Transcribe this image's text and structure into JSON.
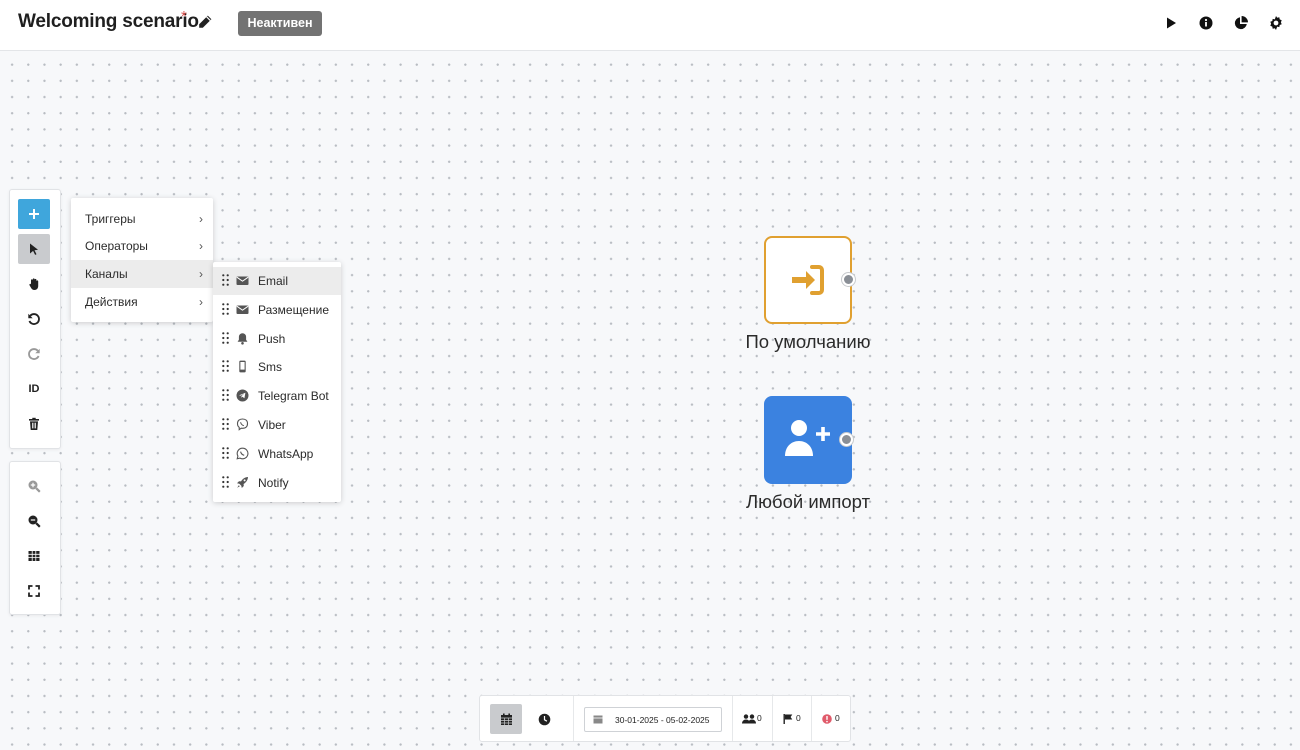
{
  "header": {
    "title": "Welcoming scenario",
    "unsaved_marker": "*",
    "status_badge": "Неактивен",
    "actions": [
      "play-icon",
      "info-icon",
      "stats-icon",
      "settings-icon"
    ]
  },
  "toolbar": {
    "tools": [
      "add",
      "select",
      "pan",
      "undo",
      "redo",
      "id",
      "delete"
    ],
    "id_label": "ID",
    "zoom_tools": [
      "zoom-in",
      "zoom-out",
      "grid",
      "fullscreen"
    ]
  },
  "add_menu": {
    "items": [
      {
        "label": "Триггеры",
        "chevron": "›"
      },
      {
        "label": "Операторы",
        "chevron": "›"
      },
      {
        "label": "Каналы",
        "chevron": "›",
        "active": true
      },
      {
        "label": "Действия",
        "chevron": "›"
      }
    ]
  },
  "channels_menu": {
    "items": [
      {
        "label": "Email",
        "icon": "envelope-icon",
        "active": true
      },
      {
        "label": "Размещение",
        "icon": "envelope-icon"
      },
      {
        "label": "Push",
        "icon": "bell-icon"
      },
      {
        "label": "Sms",
        "icon": "mobile-icon"
      },
      {
        "label": "Telegram Bot",
        "icon": "telegram-icon"
      },
      {
        "label": "Viber",
        "icon": "viber-icon"
      },
      {
        "label": "WhatsApp",
        "icon": "whatsapp-icon"
      },
      {
        "label": "Notify",
        "icon": "rocket-icon"
      }
    ]
  },
  "canvas": {
    "nodes": [
      {
        "label": "По умолчанию",
        "icon": "sign-in-icon",
        "color": "#e0a030"
      },
      {
        "label": "Любой импорт",
        "icon": "user-plus-icon",
        "color": "#3b82e0"
      }
    ]
  },
  "bottom_bar": {
    "date_range": "30-01-2025 - 05-02-2025",
    "users_count": "0",
    "flags_count": "0",
    "errors_count": "0",
    "error_color": "#e05a6a"
  }
}
